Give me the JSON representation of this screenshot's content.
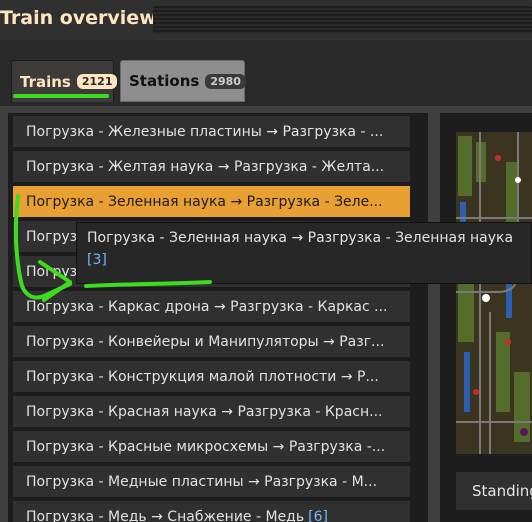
{
  "window": {
    "title": "Train overview"
  },
  "tabs": [
    {
      "label": "Trains",
      "count": "2121",
      "active": true
    },
    {
      "label": "Stations",
      "count": "2980",
      "active": false
    }
  ],
  "trains": [
    {
      "text": "Погрузка - Железные пластины → Разгрузка - ...",
      "count": ""
    },
    {
      "text": "Погрузка - Желтая наука → Разгрузка - Желта...",
      "count": ""
    },
    {
      "text": "Погрузка - Зеленная наука → Разгрузка - Зеле...",
      "count": "",
      "selected": true
    },
    {
      "text": "Погрузка",
      "count": ""
    },
    {
      "text": "Погрузка",
      "count": ""
    },
    {
      "text": "Погрузка - Каркас дрона → Разгрузка - Каркас ...",
      "count": ""
    },
    {
      "text": "Погрузка - Конвейеры и Манипуляторы → Разг...",
      "count": ""
    },
    {
      "text": "Погрузка - Конструкция малой плотности → Р...",
      "count": ""
    },
    {
      "text": "Погрузка - Красная наука → Разгрузка - Красн...",
      "count": ""
    },
    {
      "text": "Погрузка - Красные микросхемы → Разгрузка -...",
      "count": ""
    },
    {
      "text": "Погрузка - Медные пластины → Разгрузка - М...",
      "count": ""
    },
    {
      "text": "Погрузка - Медь → Снабжение - Медь",
      "count": "[6]"
    }
  ],
  "tooltip": {
    "title": "Погрузка - Зеленная наука → Разгрузка - Зеленная наука",
    "count": "[3]"
  },
  "detail": {
    "status": "Standing"
  },
  "colors": {
    "accent": "#e8a033",
    "annotation": "#3ddc1f",
    "link": "#6fb7ff"
  }
}
